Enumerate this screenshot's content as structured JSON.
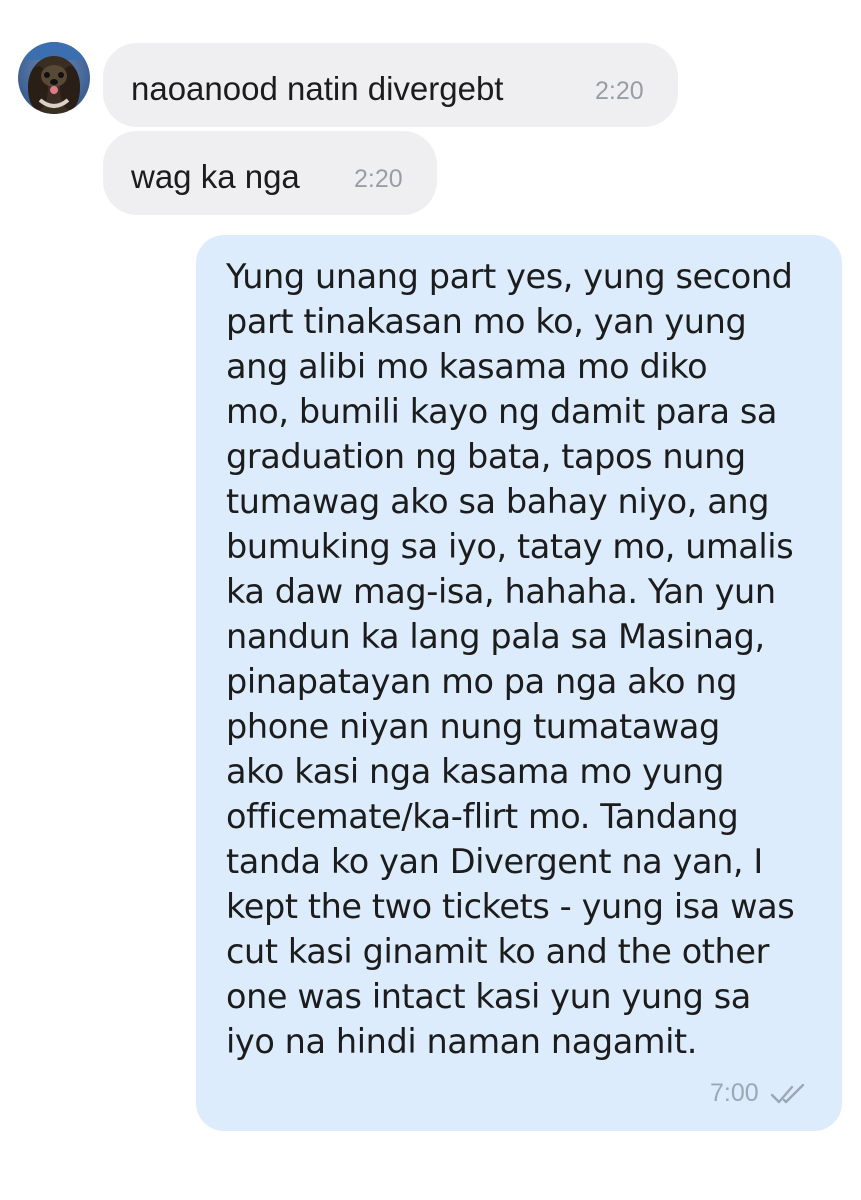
{
  "conversation": {
    "incoming": [
      {
        "text": "naoanood natin divergebt",
        "time": "2:20"
      },
      {
        "text": "wag ka nga",
        "time": "2:20"
      }
    ],
    "outgoing": {
      "lines": [
        "Yung unang part yes, yung second",
        "part tinakasan mo ko, yan yung",
        "ang alibi mo kasama mo diko",
        "mo, bumili kayo ng damit para sa",
        "graduation ng bata, tapos nung",
        "tumawag ako sa bahay niyo, ang",
        "bumuking sa iyo, tatay mo, umalis",
        "ka daw mag-isa, hahaha. Yan yun",
        "nandun ka lang pala sa Masinag,",
        "pinapatayan mo pa nga ako ng",
        "phone niyan nung tumatawag",
        "ako kasi nga kasama mo yung",
        "officemate/ka-flirt mo. Tandang",
        "tanda ko yan Divergent na yan, I",
        "kept the two tickets - yung isa was",
        "cut kasi ginamit ko and the other",
        "one was intact kasi yun yung sa",
        "iyo na hindi naman nagamit."
      ],
      "time": "7:00",
      "status_icon": "double-check-icon"
    }
  },
  "colors": {
    "incoming_bubble": "#efeff1",
    "outgoing_bubble": "#ddecfc",
    "timestamp": "#9a9ea3"
  }
}
